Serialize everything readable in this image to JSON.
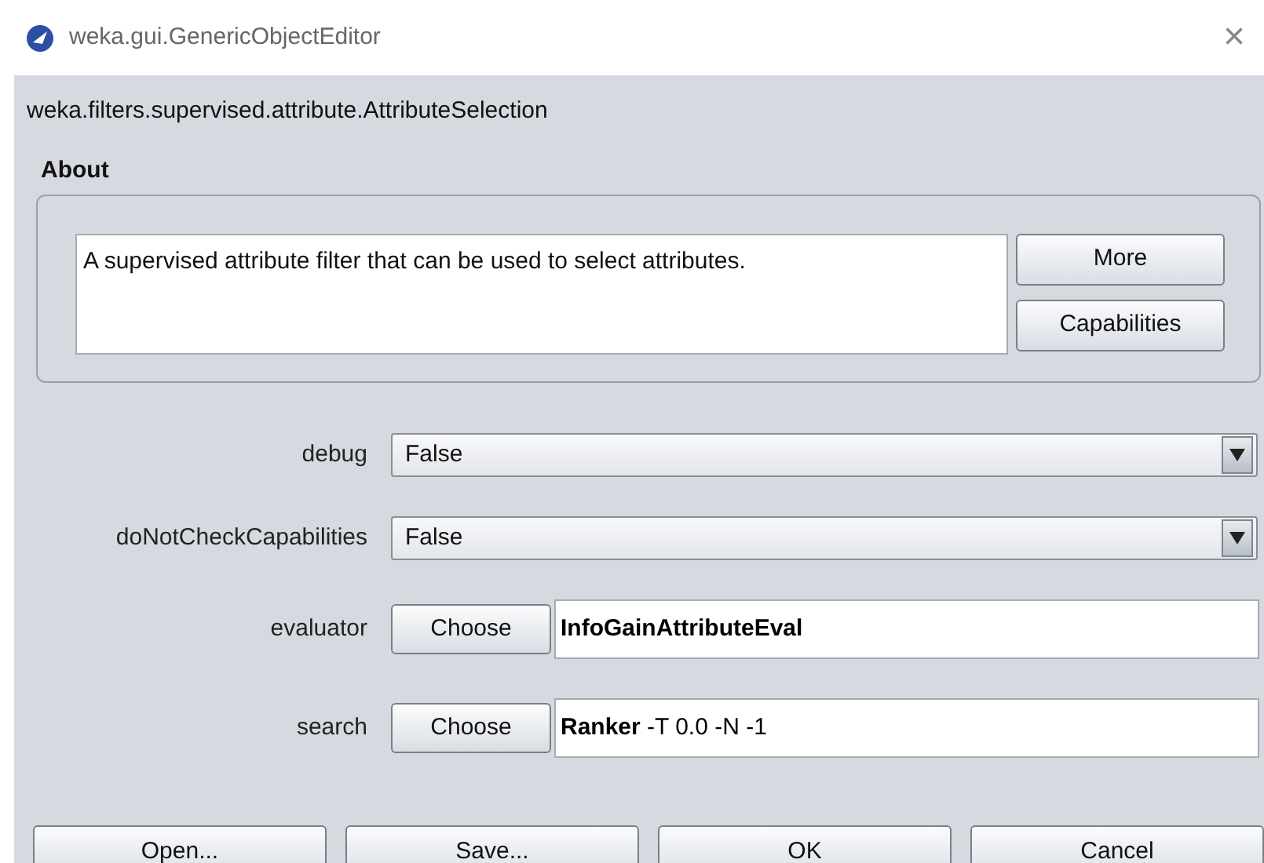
{
  "window": {
    "title": "weka.gui.GenericObjectEditor",
    "close": "×"
  },
  "class_name": "weka.filters.supervised.attribute.AttributeSelection",
  "about": {
    "heading": "About",
    "text": "A supervised attribute filter that can be used to select attributes.",
    "buttons": [
      "More",
      "Capabilities"
    ]
  },
  "properties": [
    {
      "kind": "combo",
      "label": "debug",
      "value": "False"
    },
    {
      "kind": "combo",
      "label": "doNotCheckCapabilities",
      "value": "False"
    },
    {
      "kind": "object",
      "label": "evaluator",
      "button": "Choose",
      "value": "**InfoGainAttributeEval**"
    },
    {
      "kind": "object",
      "label": "search",
      "button": "Choose",
      "value": "**Ranker** -T 0.0 -N -1"
    }
  ],
  "buttons": [
    "Open...",
    "Save...",
    "OK",
    "Cancel"
  ]
}
